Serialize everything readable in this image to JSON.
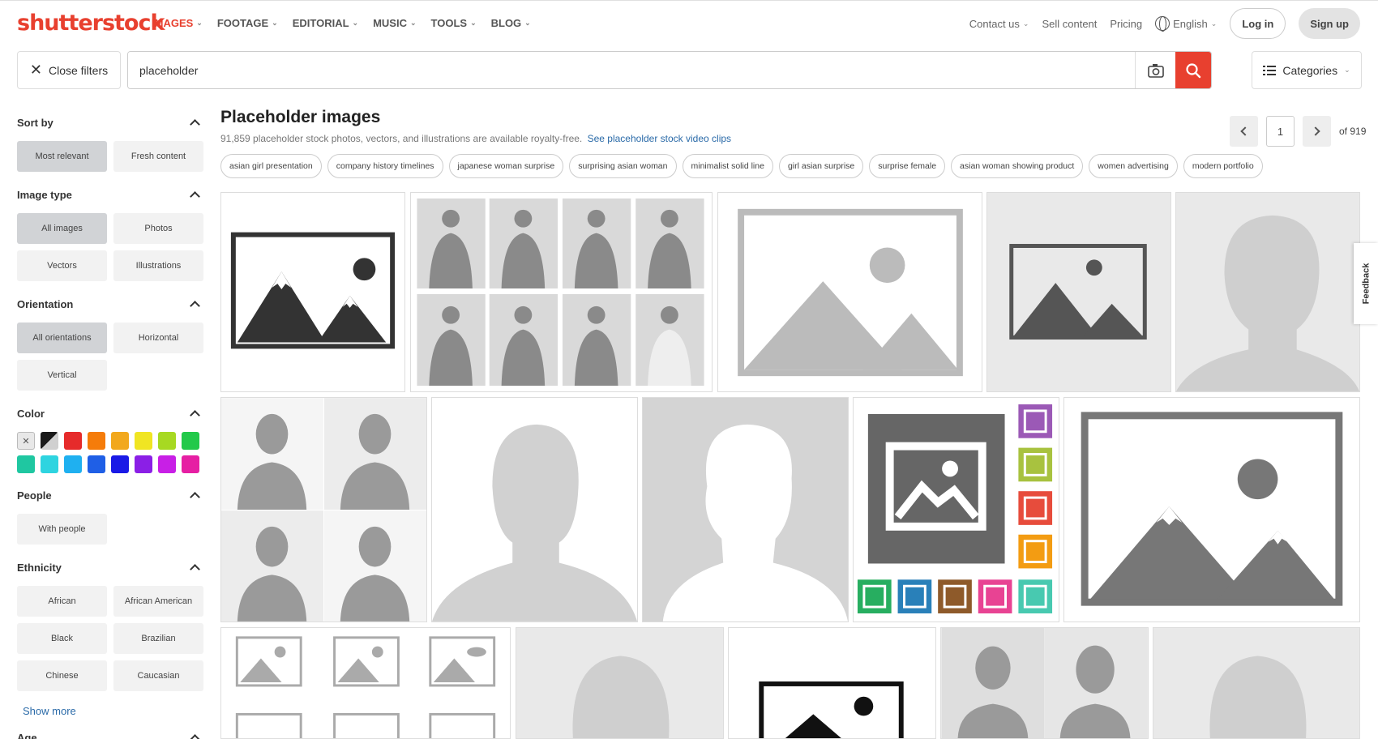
{
  "brand": {
    "logo_text": "shutterstock",
    "accent": "#e8402f"
  },
  "nav": {
    "items": [
      {
        "label": "IMAGES",
        "active": true
      },
      {
        "label": "FOOTAGE"
      },
      {
        "label": "EDITORIAL"
      },
      {
        "label": "MUSIC"
      },
      {
        "label": "TOOLS"
      },
      {
        "label": "BLOG"
      }
    ],
    "contact": "Contact us",
    "sell": "Sell content",
    "pricing": "Pricing",
    "language": "English",
    "login": "Log in",
    "signup": "Sign up"
  },
  "search": {
    "close_filters": "Close filters",
    "value": "placeholder",
    "categories": "Categories"
  },
  "filters": {
    "sort": {
      "title": "Sort by",
      "options": [
        "Most relevant",
        "Fresh content"
      ],
      "selected": "Most relevant"
    },
    "image_type": {
      "title": "Image type",
      "options": [
        "All images",
        "Photos",
        "Vectors",
        "Illustrations"
      ],
      "selected": "All images"
    },
    "orientation": {
      "title": "Orientation",
      "options": [
        "All orientations",
        "Horizontal",
        "Vertical"
      ],
      "selected": "All orientations"
    },
    "color": {
      "title": "Color",
      "swatches": [
        "none",
        "#1a1a1a",
        "#e62b2b",
        "#f57c0a",
        "#f2a81d",
        "#f0e523",
        "#a7d922",
        "#22c94a",
        "#1fc7a1",
        "#2ed4e0",
        "#1fb0f0",
        "#1f5fe6",
        "#1a1ae6",
        "#8b1fe6",
        "#c81fe6",
        "#e61fa3"
      ]
    },
    "people": {
      "title": "People",
      "options": [
        "With people"
      ]
    },
    "ethnicity": {
      "title": "Ethnicity",
      "options": [
        "African",
        "African American",
        "Black",
        "Brazilian",
        "Chinese",
        "Caucasian"
      ],
      "show_more": "Show more"
    },
    "age": {
      "title": "Age"
    }
  },
  "results": {
    "title": "Placeholder images",
    "subtitle": "91,859 placeholder stock photos, vectors, and illustrations are available royalty-free.",
    "video_link": "See placeholder stock video clips",
    "page": "1",
    "of_pages": "of 919",
    "tags": [
      "asian girl presentation",
      "company history timelines",
      "japanese woman surprise",
      "surprising asian woman",
      "minimalist solid line",
      "girl asian surprise",
      "surprise female",
      "asian woman showing product",
      "women advertising",
      "modern portfolio"
    ]
  },
  "feedback": "Feedback"
}
